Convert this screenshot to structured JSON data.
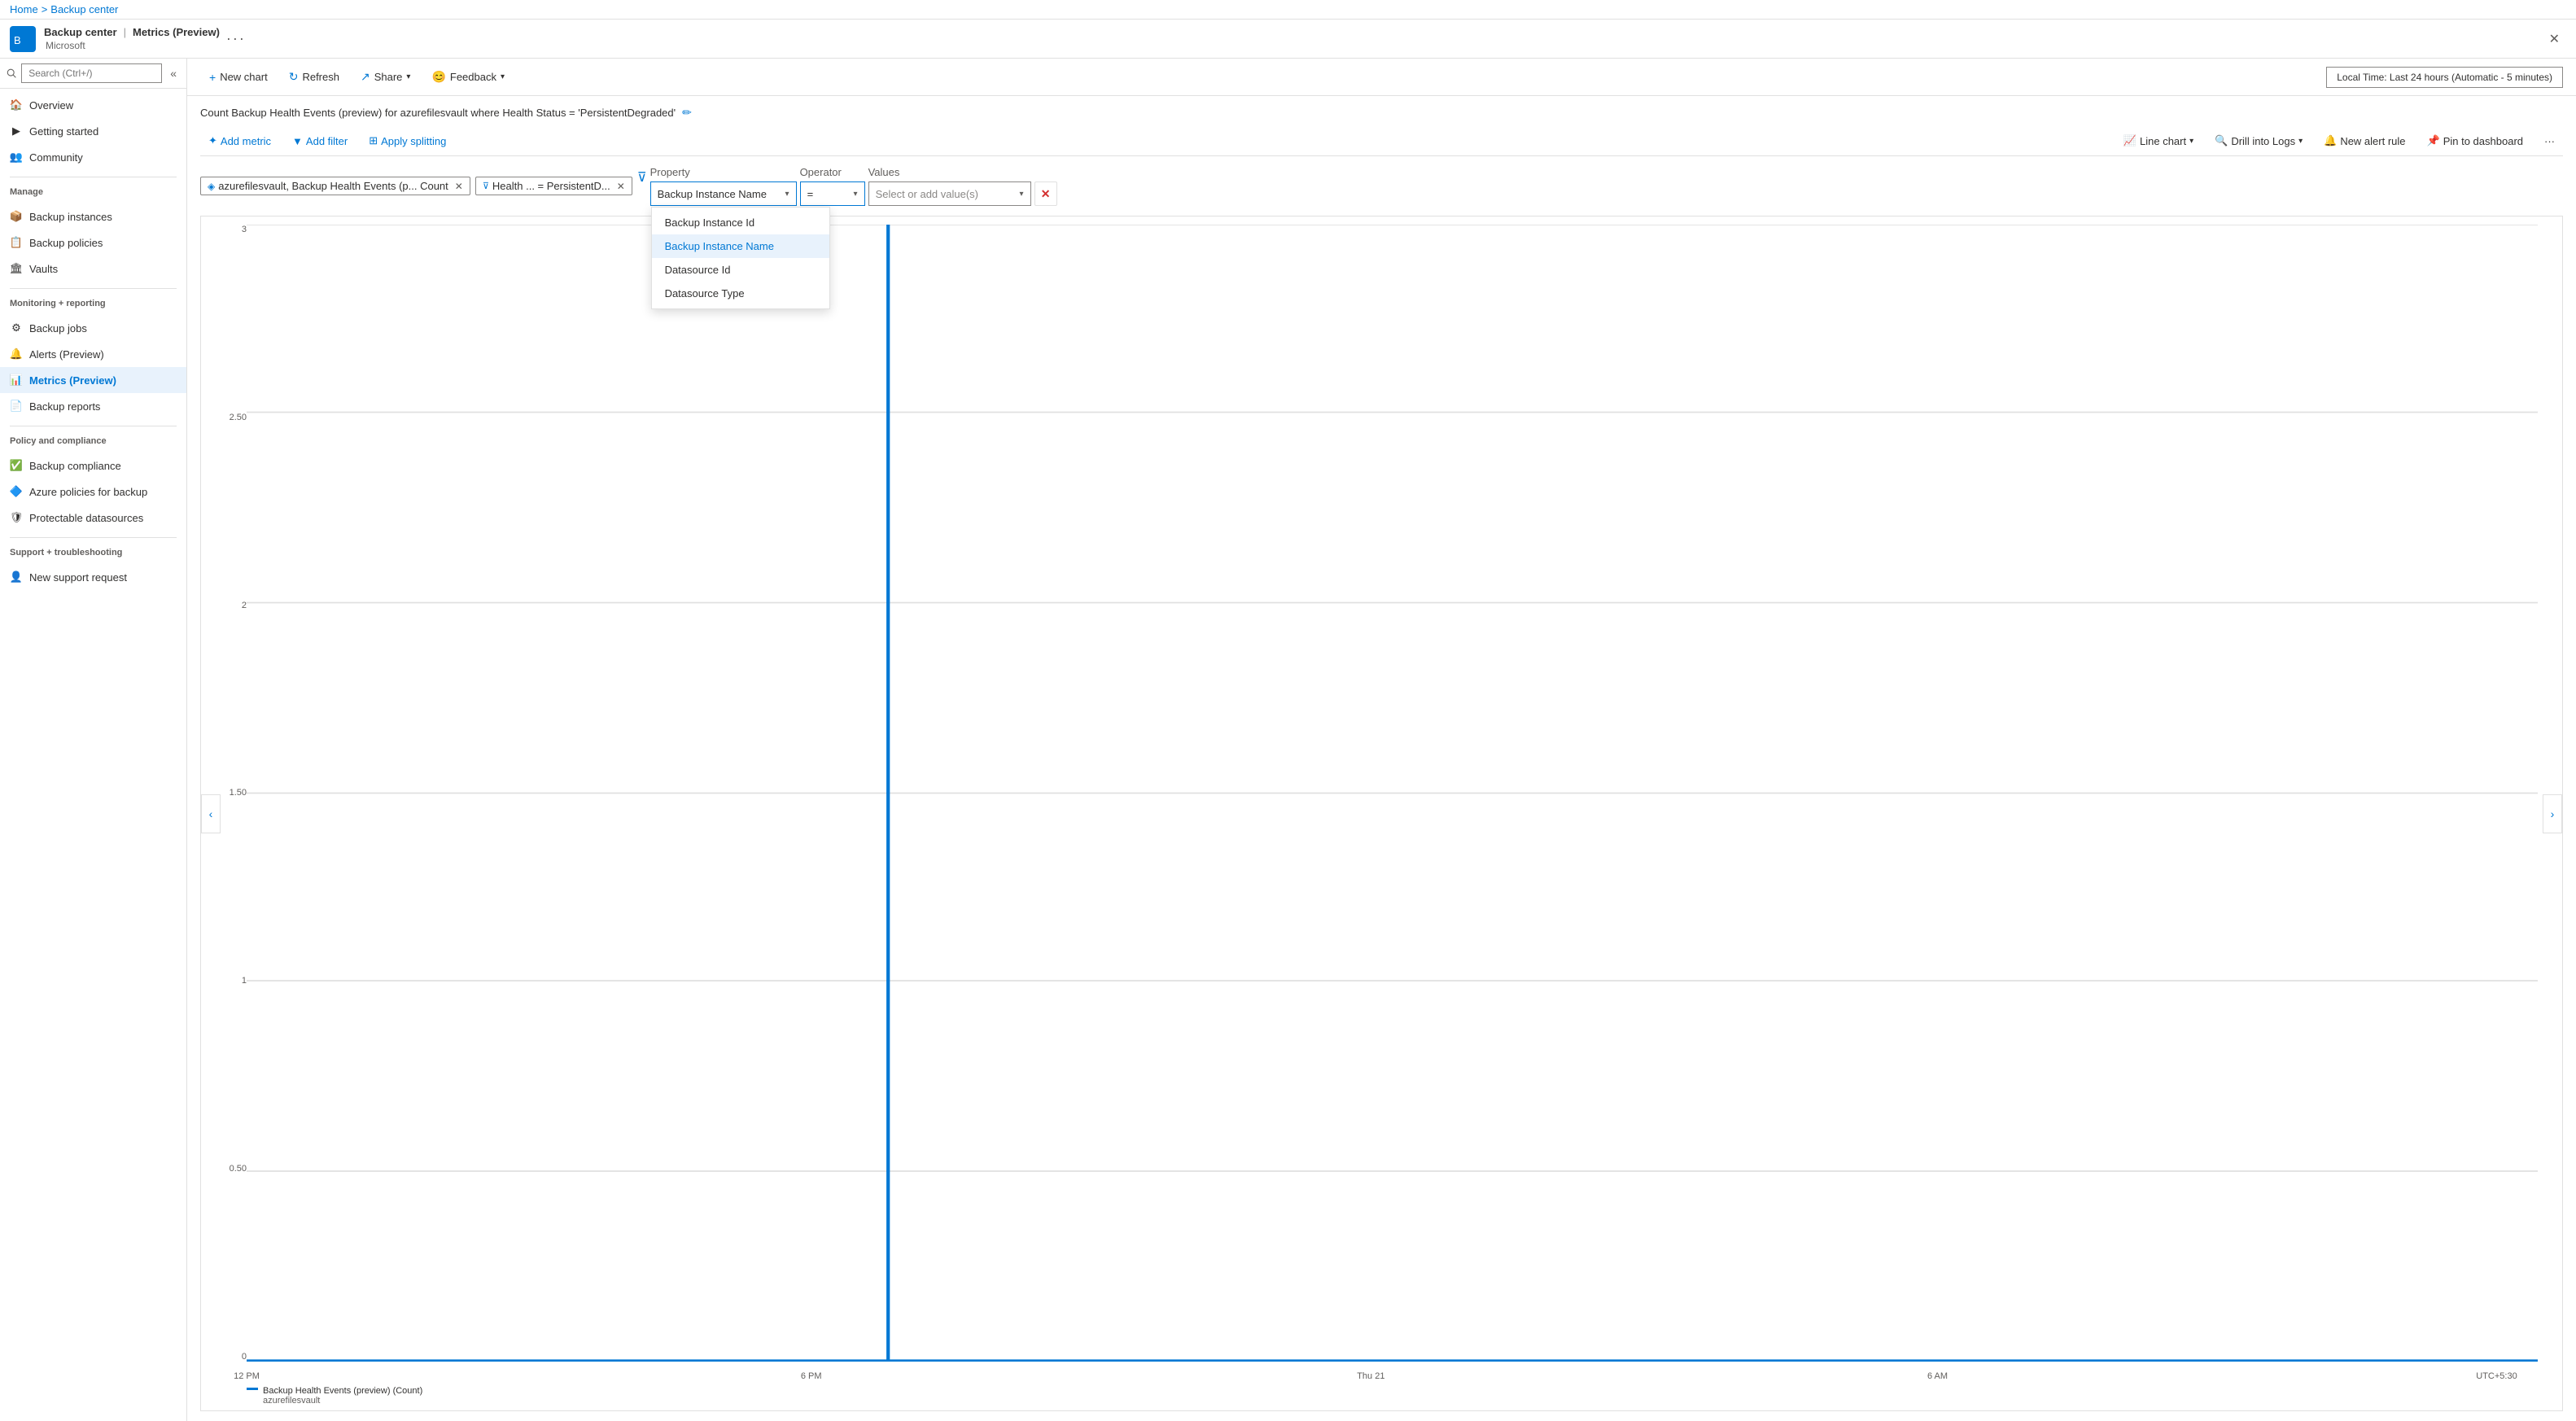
{
  "breadcrumb": {
    "home": "Home",
    "sep": ">",
    "current": "Backup center"
  },
  "header": {
    "title": "Backup center",
    "separator": "|",
    "subtitle": "Metrics (Preview)",
    "microsoft": "Microsoft",
    "more": "···",
    "close": "✕"
  },
  "search": {
    "placeholder": "Search (Ctrl+/)"
  },
  "sidebar": {
    "sections": [
      {
        "items": [
          {
            "label": "Overview",
            "icon": "🏠",
            "active": false
          },
          {
            "label": "Getting started",
            "icon": "▶",
            "active": false
          },
          {
            "label": "Community",
            "icon": "👥",
            "active": false
          }
        ]
      },
      {
        "title": "Manage",
        "items": [
          {
            "label": "Backup instances",
            "icon": "📦",
            "active": false
          },
          {
            "label": "Backup policies",
            "icon": "📋",
            "active": false
          },
          {
            "label": "Vaults",
            "icon": "🏛",
            "active": false
          }
        ]
      },
      {
        "title": "Monitoring + reporting",
        "items": [
          {
            "label": "Backup jobs",
            "icon": "⚙",
            "active": false
          },
          {
            "label": "Alerts (Preview)",
            "icon": "🔔",
            "active": false
          },
          {
            "label": "Metrics (Preview)",
            "icon": "📊",
            "active": true
          },
          {
            "label": "Backup reports",
            "icon": "📄",
            "active": false
          }
        ]
      },
      {
        "title": "Policy and compliance",
        "items": [
          {
            "label": "Backup compliance",
            "icon": "✅",
            "active": false
          },
          {
            "label": "Azure policies for backup",
            "icon": "🔷",
            "active": false
          },
          {
            "label": "Protectable datasources",
            "icon": "🛡",
            "active": false
          }
        ]
      },
      {
        "title": "Support + troubleshooting",
        "items": [
          {
            "label": "New support request",
            "icon": "👤",
            "active": false
          }
        ]
      }
    ]
  },
  "toolbar": {
    "new_chart": "New chart",
    "refresh": "Refresh",
    "share": "Share",
    "feedback": "Feedback",
    "time_range": "Local Time: Last 24 hours (Automatic - 5 minutes)"
  },
  "chart": {
    "title": "Count Backup Health Events (preview) for azurefilesvault where Health Status = 'PersistentDegraded'",
    "edit_icon": "✏",
    "filter_buttons": [
      {
        "label": "Add metric",
        "icon": "+"
      },
      {
        "label": "Add filter",
        "icon": "▼"
      },
      {
        "label": "Apply splitting",
        "icon": "⊞"
      }
    ],
    "right_buttons": [
      {
        "label": "Line chart",
        "icon": "📈"
      },
      {
        "label": "Drill into Logs",
        "icon": "🔍"
      },
      {
        "label": "New alert rule",
        "icon": "🔔"
      },
      {
        "label": "Pin to dashboard",
        "icon": "📌"
      },
      {
        "label": "···"
      }
    ],
    "active_filters": [
      {
        "icon": "azure",
        "text": "azurefilesvault, Backup Health Events (p... Count",
        "has_close": true
      },
      {
        "icon": "filter",
        "text": "Health ... = PersistentD...",
        "has_close": true
      }
    ],
    "property_filter": {
      "label_property": "Property",
      "label_operator": "Operator",
      "label_values": "Values",
      "selected_property": "Backup Instance Name",
      "selected_operator": "=",
      "values_placeholder": "Select or add value(s)",
      "dropdown_items": [
        {
          "label": "Backup Instance Id",
          "selected": false
        },
        {
          "label": "Backup Instance Name",
          "selected": true
        },
        {
          "label": "Datasource Id",
          "selected": false
        },
        {
          "label": "Datasource Type",
          "selected": false
        }
      ]
    },
    "y_axis_labels": [
      "3",
      "2.50",
      "2",
      "1.50",
      "1",
      "0.50",
      "0"
    ],
    "x_axis_labels": [
      "12 PM",
      "6 PM",
      "Thu 21",
      "6 AM",
      "UTC+5:30"
    ],
    "legend": {
      "title": "Backup Health Events (preview) (Count)",
      "subtitle": "azurefilesvault"
    },
    "vertical_line_pos": 0.28
  }
}
